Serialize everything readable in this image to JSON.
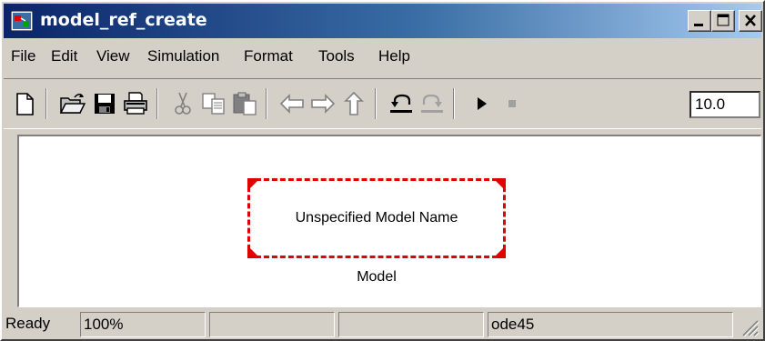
{
  "window": {
    "title": "model_ref_create",
    "icon": "simulink-model-icon"
  },
  "caption_buttons": [
    {
      "name": "minimize-button",
      "icon": "minimize-icon"
    },
    {
      "name": "maximize-button",
      "icon": "maximize-icon"
    },
    {
      "name": "close-button",
      "icon": "close-icon"
    }
  ],
  "menu": {
    "file": "File",
    "edit": "Edit",
    "view": "View",
    "simulation": "Simulation",
    "format": "Format",
    "tools": "Tools",
    "help": "Help"
  },
  "toolbar": {
    "icons": [
      "new-file-icon",
      "open-folder-icon",
      "save-icon",
      "print-icon",
      "cut-icon",
      "copy-icon",
      "paste-icon",
      "back-arrow-icon",
      "forward-arrow-icon",
      "up-arrow-icon",
      "undo-icon",
      "redo-icon",
      "start-simulation-icon",
      "stop-simulation-icon"
    ],
    "stop_time": "10.0"
  },
  "canvas": {
    "block_text": "Unspecified Model Name",
    "block_caption": "Model",
    "block_color": "#e00000"
  },
  "status": {
    "ready": "Ready",
    "zoom": "100%",
    "panel2": "",
    "panel3": "",
    "solver": "ode45"
  },
  "colors": {
    "title_gradient_start": "#0a246a",
    "title_gradient_end": "#a6caf0",
    "chrome": "#d4d0c8"
  }
}
